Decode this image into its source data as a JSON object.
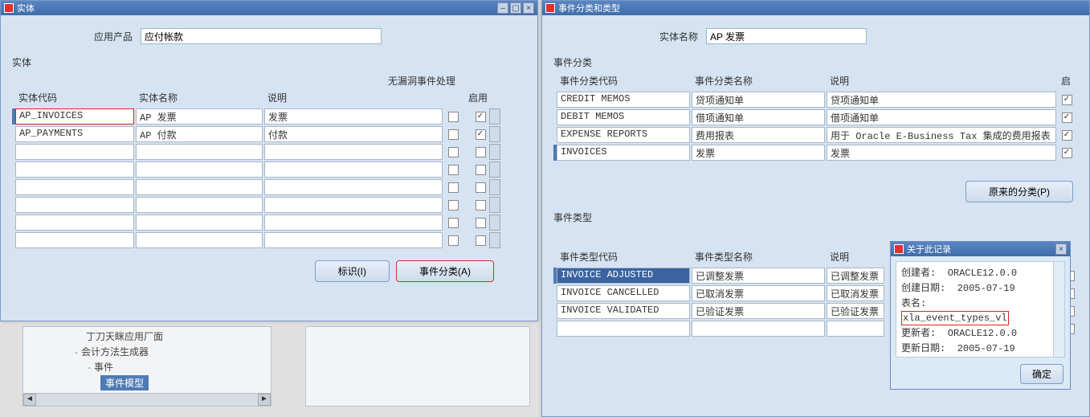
{
  "left_window": {
    "title": "实体",
    "app_label": "应用产品",
    "app_value": "应付帐款",
    "group_label": "实体",
    "sub_header": "无漏洞事件处理",
    "columns": {
      "code": "实体代码",
      "name": "实体名称",
      "desc": "说明",
      "enabled": "启用"
    },
    "rows": [
      {
        "code": "AP_INVOICES",
        "name": "AP 发票",
        "desc": "发票",
        "c1": false,
        "c2": true,
        "active": true,
        "hl": true
      },
      {
        "code": "AP_PAYMENTS",
        "name": "AP 付款",
        "desc": "付款",
        "c1": false,
        "c2": true,
        "active": false,
        "hl": false
      }
    ],
    "empty_rows": 6,
    "btn_identify": "标识(I)",
    "btn_classify": "事件分类(A)"
  },
  "tree": {
    "line1": "丁刀天眯应用厂面",
    "line2": "会计方法生成器",
    "line3": "事件",
    "selected": "事件模型"
  },
  "right_window": {
    "title": "事件分类和类型",
    "entity_label": "实体名称",
    "entity_value": "AP 发票",
    "class_group": "事件分类",
    "class_columns": {
      "code": "事件分类代码",
      "name": "事件分类名称",
      "desc": "说明",
      "enabled": "启"
    },
    "class_rows": [
      {
        "code": "CREDIT MEMOS",
        "name": "贷项通知单",
        "desc": "贷项通知单",
        "en": true
      },
      {
        "code": "DEBIT MEMOS",
        "name": "借项通知单",
        "desc": "借项通知单",
        "en": true
      },
      {
        "code": "EXPENSE REPORTS",
        "name": "费用报表",
        "desc": "用于 Oracle E-Business Tax 集成的费用报表",
        "en": true
      },
      {
        "code": "INVOICES",
        "name": "发票",
        "desc": "发票",
        "en": true,
        "active": true
      }
    ],
    "btn_original": "原来的分类(P)",
    "type_group": "事件类型",
    "type_columns": {
      "code": "事件类型代码",
      "name": "事件类型名称",
      "desc": "说明",
      "enabled": "启"
    },
    "type_rows": [
      {
        "code": "INVOICE ADJUSTED",
        "name": "已调整发票",
        "desc": "已调整发票",
        "en": true,
        "active": true,
        "sel": true
      },
      {
        "code": "INVOICE CANCELLED",
        "name": "已取消发票",
        "desc": "已取消发票",
        "en": true
      },
      {
        "code": "INVOICE VALIDATED",
        "name": "已验证发票",
        "desc": "已验证发票",
        "en": true
      }
    ]
  },
  "about": {
    "title": "关于此记录",
    "lines": {
      "l1a": "创建者:",
      "l1b": "ORACLE12.0.0",
      "l2a": "创建日期:",
      "l2b": "2005-07-19",
      "l3": "表名:",
      "l4": "xla_event_types_vl",
      "l5a": "更新者:",
      "l5b": "ORACLE12.0.0",
      "l6a": "更新日期:",
      "l6b": "2005-07-19"
    },
    "btn_ok": "确定"
  }
}
